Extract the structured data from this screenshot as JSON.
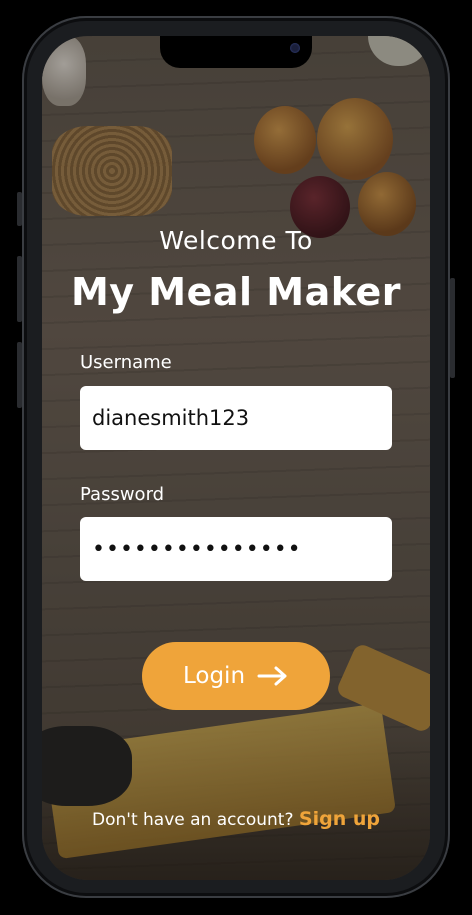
{
  "welcome": {
    "line1": "Welcome To",
    "title": "My Meal Maker"
  },
  "form": {
    "username_label": "Username",
    "username_value": "dianesmith123",
    "password_label": "Password",
    "password_value": "•••••••••••••••"
  },
  "login": {
    "label": "Login",
    "icon": "arrow-right-icon"
  },
  "signup": {
    "prompt": "Don't have an account?",
    "link": "Sign up"
  },
  "colors": {
    "accent": "#efa43a",
    "field_bg": "#ffffff",
    "text": "#ffffff"
  }
}
